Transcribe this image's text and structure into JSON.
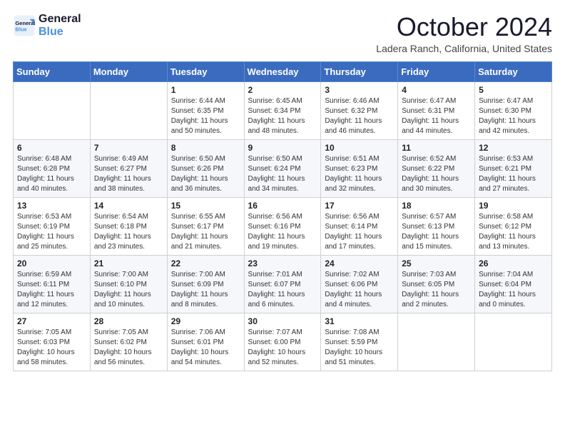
{
  "logo": {
    "line1": "General",
    "line2": "Blue"
  },
  "title": "October 2024",
  "location": "Ladera Ranch, California, United States",
  "days_of_week": [
    "Sunday",
    "Monday",
    "Tuesday",
    "Wednesday",
    "Thursday",
    "Friday",
    "Saturday"
  ],
  "weeks": [
    [
      {
        "day": "",
        "info": ""
      },
      {
        "day": "",
        "info": ""
      },
      {
        "day": "1",
        "info": "Sunrise: 6:44 AM\nSunset: 6:35 PM\nDaylight: 11 hours and 50 minutes."
      },
      {
        "day": "2",
        "info": "Sunrise: 6:45 AM\nSunset: 6:34 PM\nDaylight: 11 hours and 48 minutes."
      },
      {
        "day": "3",
        "info": "Sunrise: 6:46 AM\nSunset: 6:32 PM\nDaylight: 11 hours and 46 minutes."
      },
      {
        "day": "4",
        "info": "Sunrise: 6:47 AM\nSunset: 6:31 PM\nDaylight: 11 hours and 44 minutes."
      },
      {
        "day": "5",
        "info": "Sunrise: 6:47 AM\nSunset: 6:30 PM\nDaylight: 11 hours and 42 minutes."
      }
    ],
    [
      {
        "day": "6",
        "info": "Sunrise: 6:48 AM\nSunset: 6:28 PM\nDaylight: 11 hours and 40 minutes."
      },
      {
        "day": "7",
        "info": "Sunrise: 6:49 AM\nSunset: 6:27 PM\nDaylight: 11 hours and 38 minutes."
      },
      {
        "day": "8",
        "info": "Sunrise: 6:50 AM\nSunset: 6:26 PM\nDaylight: 11 hours and 36 minutes."
      },
      {
        "day": "9",
        "info": "Sunrise: 6:50 AM\nSunset: 6:24 PM\nDaylight: 11 hours and 34 minutes."
      },
      {
        "day": "10",
        "info": "Sunrise: 6:51 AM\nSunset: 6:23 PM\nDaylight: 11 hours and 32 minutes."
      },
      {
        "day": "11",
        "info": "Sunrise: 6:52 AM\nSunset: 6:22 PM\nDaylight: 11 hours and 30 minutes."
      },
      {
        "day": "12",
        "info": "Sunrise: 6:53 AM\nSunset: 6:21 PM\nDaylight: 11 hours and 27 minutes."
      }
    ],
    [
      {
        "day": "13",
        "info": "Sunrise: 6:53 AM\nSunset: 6:19 PM\nDaylight: 11 hours and 25 minutes."
      },
      {
        "day": "14",
        "info": "Sunrise: 6:54 AM\nSunset: 6:18 PM\nDaylight: 11 hours and 23 minutes."
      },
      {
        "day": "15",
        "info": "Sunrise: 6:55 AM\nSunset: 6:17 PM\nDaylight: 11 hours and 21 minutes."
      },
      {
        "day": "16",
        "info": "Sunrise: 6:56 AM\nSunset: 6:16 PM\nDaylight: 11 hours and 19 minutes."
      },
      {
        "day": "17",
        "info": "Sunrise: 6:56 AM\nSunset: 6:14 PM\nDaylight: 11 hours and 17 minutes."
      },
      {
        "day": "18",
        "info": "Sunrise: 6:57 AM\nSunset: 6:13 PM\nDaylight: 11 hours and 15 minutes."
      },
      {
        "day": "19",
        "info": "Sunrise: 6:58 AM\nSunset: 6:12 PM\nDaylight: 11 hours and 13 minutes."
      }
    ],
    [
      {
        "day": "20",
        "info": "Sunrise: 6:59 AM\nSunset: 6:11 PM\nDaylight: 11 hours and 12 minutes."
      },
      {
        "day": "21",
        "info": "Sunrise: 7:00 AM\nSunset: 6:10 PM\nDaylight: 11 hours and 10 minutes."
      },
      {
        "day": "22",
        "info": "Sunrise: 7:00 AM\nSunset: 6:09 PM\nDaylight: 11 hours and 8 minutes."
      },
      {
        "day": "23",
        "info": "Sunrise: 7:01 AM\nSunset: 6:07 PM\nDaylight: 11 hours and 6 minutes."
      },
      {
        "day": "24",
        "info": "Sunrise: 7:02 AM\nSunset: 6:06 PM\nDaylight: 11 hours and 4 minutes."
      },
      {
        "day": "25",
        "info": "Sunrise: 7:03 AM\nSunset: 6:05 PM\nDaylight: 11 hours and 2 minutes."
      },
      {
        "day": "26",
        "info": "Sunrise: 7:04 AM\nSunset: 6:04 PM\nDaylight: 11 hours and 0 minutes."
      }
    ],
    [
      {
        "day": "27",
        "info": "Sunrise: 7:05 AM\nSunset: 6:03 PM\nDaylight: 10 hours and 58 minutes."
      },
      {
        "day": "28",
        "info": "Sunrise: 7:05 AM\nSunset: 6:02 PM\nDaylight: 10 hours and 56 minutes."
      },
      {
        "day": "29",
        "info": "Sunrise: 7:06 AM\nSunset: 6:01 PM\nDaylight: 10 hours and 54 minutes."
      },
      {
        "day": "30",
        "info": "Sunrise: 7:07 AM\nSunset: 6:00 PM\nDaylight: 10 hours and 52 minutes."
      },
      {
        "day": "31",
        "info": "Sunrise: 7:08 AM\nSunset: 5:59 PM\nDaylight: 10 hours and 51 minutes."
      },
      {
        "day": "",
        "info": ""
      },
      {
        "day": "",
        "info": ""
      }
    ]
  ]
}
